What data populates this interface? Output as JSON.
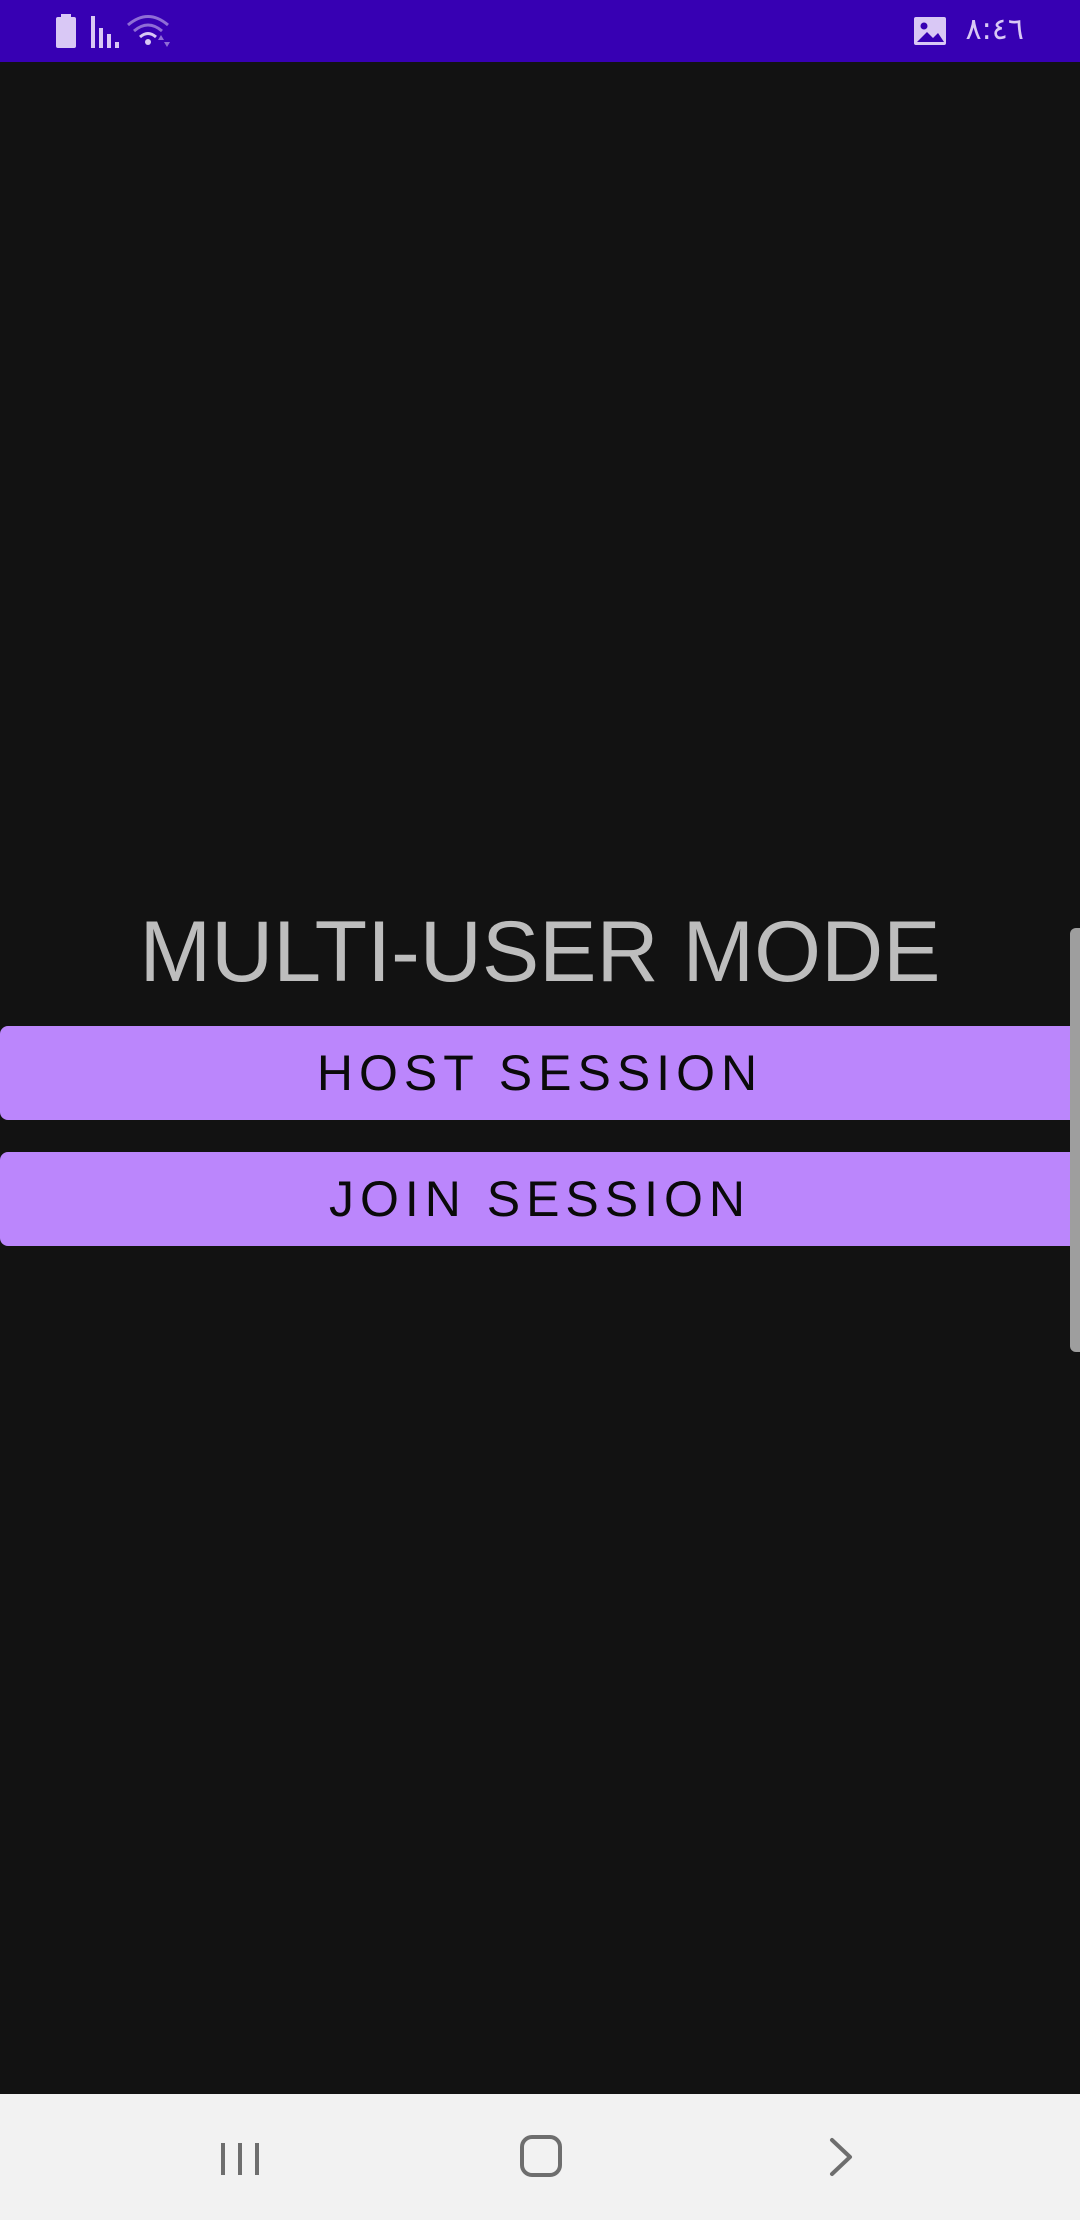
{
  "status_bar": {
    "time": "٨:٤٦",
    "icons": [
      "battery-icon",
      "signal-icon",
      "wifi-icon",
      "gallery-icon"
    ],
    "background_color": "#3700b3"
  },
  "main": {
    "title": "MULTI-USER MODE",
    "host_button_label": "HOST SESSION",
    "join_button_label": "JOIN SESSION",
    "accent_color": "#bb86fc",
    "background_color": "#121212"
  },
  "nav_bar": {
    "icons": [
      "recents-icon",
      "home-icon",
      "back-icon"
    ]
  }
}
